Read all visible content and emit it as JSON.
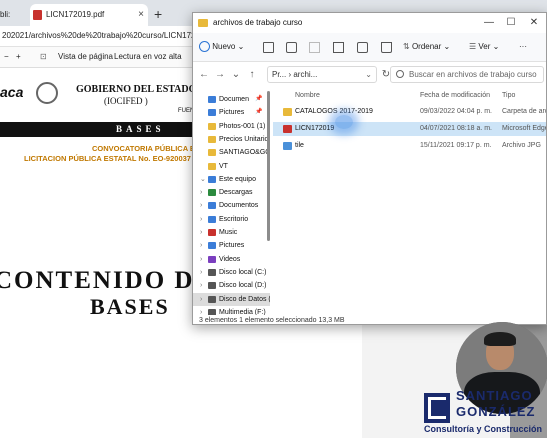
{
  "browser": {
    "tab1_label": "bli:",
    "tab2_label": "LICN172019.pdf",
    "tab2_close": "×",
    "newtab": "+",
    "address": "202021/archivos%20de%20trabajo%20curso/LICN172019.pdf",
    "toolbar": {
      "less": "−",
      "plus": "+",
      "fit": "⊡",
      "page_view_label": "Vista de página",
      "read_aloud_label": "Lectura en voz alta"
    }
  },
  "pdf": {
    "logo_text": "aca",
    "gov_title": "GOBIERNO DEL ESTADO DE",
    "gov_sub": "(IOCIFED )",
    "gov_sub2": "FUEN",
    "bases_bar": "BASES",
    "convocatoria": "CONVOCATORIA PÚBLICA ESTATA",
    "licitacion": "LICITACION PÚBLICA ESTATAL No. EO-920037",
    "big_title_1": "CONTENIDO D",
    "big_title_2": "BASES",
    "watermark": "oaxaca"
  },
  "explorer": {
    "title": "archivos de trabajo curso",
    "window_controls": {
      "minimize": "—",
      "maximize": "☐",
      "close": "✕"
    },
    "cmdbar": {
      "new_label": "Nuevo",
      "new_chevron": "⌄",
      "sort_label": "Ordenar",
      "view_label": "Ver",
      "more": "···"
    },
    "nav": {
      "back": "←",
      "forward": "→",
      "recent": "⌄",
      "up": "↑",
      "address": "Pr... › archi...",
      "address_chevron": "⌄",
      "refresh": "↻",
      "search_placeholder": "Buscar en archivos de trabajo curso"
    },
    "sidebar": {
      "items": [
        {
          "label": "Documen",
          "chevron": "",
          "pin": "📌"
        },
        {
          "label": "Pictures",
          "chevron": "",
          "pin": "📌"
        },
        {
          "label": "Photos-001 (1)",
          "chevron": "",
          "pin": ""
        },
        {
          "label": "Precios Unitarios",
          "chevron": "",
          "pin": ""
        },
        {
          "label": "SANTIAGO&GO",
          "chevron": "",
          "pin": ""
        },
        {
          "label": "VT",
          "chevron": "",
          "pin": ""
        },
        {
          "label": "Este equipo",
          "chevron": "⌄",
          "pin": ""
        },
        {
          "label": "Descargas",
          "chevron": "›",
          "pin": ""
        },
        {
          "label": "Documentos",
          "chevron": "›",
          "pin": ""
        },
        {
          "label": "Escritorio",
          "chevron": "›",
          "pin": ""
        },
        {
          "label": "Music",
          "chevron": "›",
          "pin": ""
        },
        {
          "label": "Pictures",
          "chevron": "›",
          "pin": ""
        },
        {
          "label": "Videos",
          "chevron": "›",
          "pin": ""
        },
        {
          "label": "Disco local (C:)",
          "chevron": "›",
          "pin": ""
        },
        {
          "label": "Disco local (D:)",
          "chevron": "›",
          "pin": ""
        },
        {
          "label": "Disco de Datos (",
          "chevron": "›",
          "pin": ""
        },
        {
          "label": "Multimedia (F:)",
          "chevron": "›",
          "pin": ""
        }
      ]
    },
    "columns": {
      "name": "Nombre",
      "date": "Fecha de modificación",
      "type": "Tipo"
    },
    "files": [
      {
        "name": "CATALOGOS 2017-2019",
        "date": "09/03/2022 04:04 p. m.",
        "type": "Carpeta de archivos",
        "icon_color": "#e8b93a"
      },
      {
        "name": "LICN172019",
        "date": "04/07/2021 08:18 a. m.",
        "type": "Microsoft Edge PDF",
        "icon_color": "#c8312d"
      },
      {
        "name": "tile",
        "date": "15/11/2021 09:17 p. m.",
        "type": "Archivo JPG",
        "icon_color": "#4a90d9"
      }
    ],
    "status": "3 elementos     1 elemento seleccionado  13,3 MB"
  },
  "brand": {
    "name_line1": "SANTIAGO",
    "name_line2": "GONZÁLEZ",
    "tagline": "Consultoría y Construcción"
  },
  "colors": {
    "folder": "#e8b93a",
    "pdf": "#c8312d",
    "selection": "#cde4f7",
    "brand": "#1a2a6c"
  }
}
